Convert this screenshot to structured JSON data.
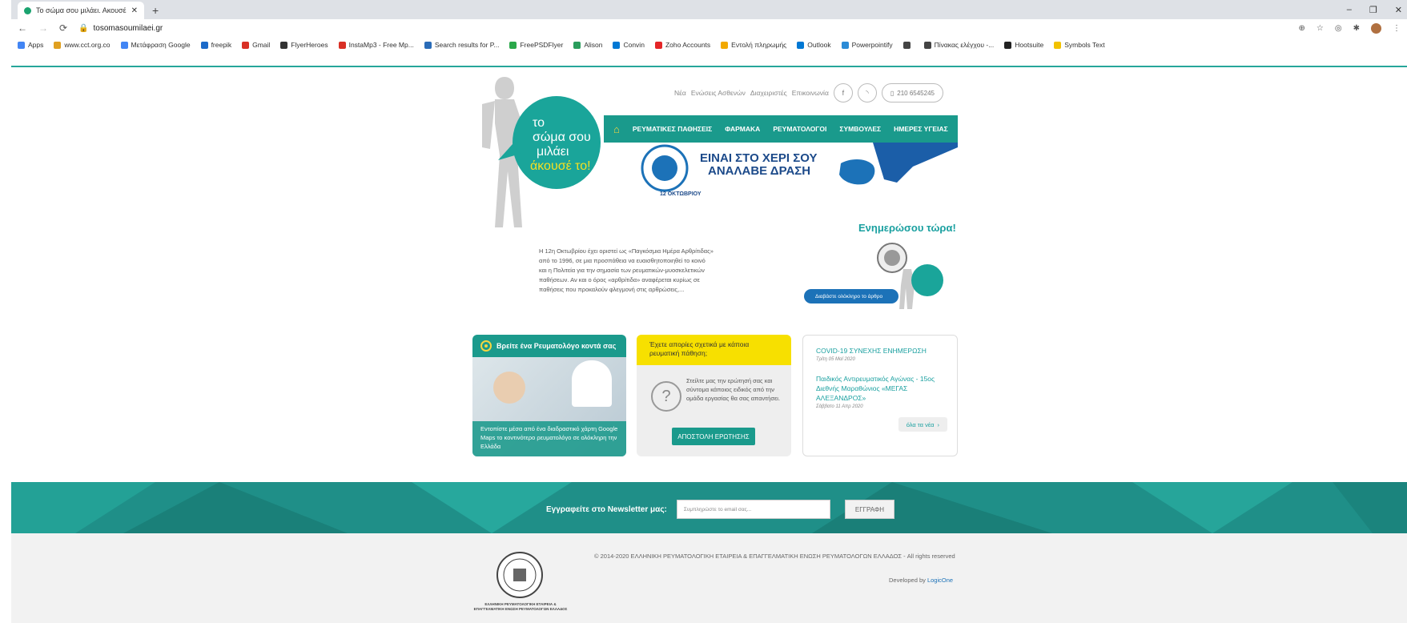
{
  "browser": {
    "tab_title": "Το σώμα σου μιλάει. Ακουσέ το!",
    "url": "tosomasoumilaei.gr",
    "bookmarks": [
      {
        "label": "Apps",
        "color": "#4285f4"
      },
      {
        "label": "www.cct.org.co",
        "color": "#e0a020"
      },
      {
        "label": "Μετάφραση Google",
        "color": "#4285f4"
      },
      {
        "label": "freepik",
        "color": "#1b6ac9"
      },
      {
        "label": "Gmail",
        "color": "#d93025"
      },
      {
        "label": "FlyerHeroes",
        "color": "#333333"
      },
      {
        "label": "InstaMp3 - Free Mp...",
        "color": "#d93025"
      },
      {
        "label": "Search results for P...",
        "color": "#2a6cb8"
      },
      {
        "label": "FreePSDFlyer",
        "color": "#2aa84a"
      },
      {
        "label": "Alison",
        "color": "#2a9d5c"
      },
      {
        "label": "Convin",
        "color": "#0078d4"
      },
      {
        "label": "Zoho Accounts",
        "color": "#e42527"
      },
      {
        "label": "Εντολή πληρωμής",
        "color": "#f2a900"
      },
      {
        "label": "Outlook",
        "color": "#0078d4"
      },
      {
        "label": "Powerpointify",
        "color": "#2b8bd6"
      },
      {
        "label": "",
        "color": "#444444"
      },
      {
        "label": "Πίνακας ελέγχου -...",
        "color": "#444444"
      },
      {
        "label": "Hootsuite",
        "color": "#222222"
      },
      {
        "label": "Symbols Text",
        "color": "#f2c200"
      }
    ]
  },
  "site": {
    "logo": {
      "line1": "το",
      "line2": "σώμα σου",
      "line3": "μιλάει",
      "line4": "άκουσέ το!"
    },
    "topnav": {
      "news": "Νέα",
      "patients": "Ενώσεις Ασθενών",
      "admins": "Διαχειριστές",
      "contact": "Επικοινωνία",
      "phone": "210 6545245"
    },
    "menu": [
      "ΡΕΥΜΑΤΙΚΕΣ ΠΑΘΗΣΕΙΣ",
      "ΦΑΡΜΑΚΑ",
      "ΡΕΥΜΑΤΟΛΟΓΟΙ",
      "ΣΥΜΒΟΥΛΕΣ",
      "ΗΜΕΡΕΣ ΥΓΕΙΑΣ"
    ],
    "banner": {
      "line1": "ΕΙΝΑΙ ΣΤΟ ΧΕΡΙ ΣΟΥ",
      "line2": "ΑΝΑΛΑΒΕ ΔΡΑΣΗ",
      "badge": "12 ΟΚΤΩΒΡΙΟΥ"
    },
    "inform_title": "Ενημερώσου τώρα!",
    "intro": "Η 12η Οκτωβρίου έχει οριστεί ως «Παγκόσμια Ημέρα Αρθρίτιδας» από το 1996, σε μια προσπάθεια να ευαισθητοποιηθεί το κοινό και η Πολιτεία για την σημασία των ρευματικών-μυοσκελετικών παθήσεων. Αν και ο όρος «αρθρίτιδα» αναφέρεται κυρίως σε παθήσεις που προκαλούν φλεγμονή στις αρθρώσεις,...",
    "readmore": "Διαβάστε ολόκληρο το άρθρο",
    "card_find": {
      "title": "Βρείτε ένα Ρευματολόγο κοντά σας",
      "caption": "Εντοπίστε μέσα από ένα διαδραστικό χάρτη Google Maps το κοντινότερο ρευματολόγο σε ολόκληρη την Ελλάδα"
    },
    "card_ask": {
      "title": "Έχετε απορίες σχετικά με κάποια ρευματική πάθηση;",
      "text": "Στείλτε μας την ερώτησή σας και σύντομα κάποιος ειδικός από την ομάδα εργασίας θα σας απαντήσει.",
      "button": "ΑΠΟΣΤΟΛΗ ΕΡΩΤΗΣΗΣ"
    },
    "card_news": {
      "item1_title": "COVID-19 ΣΥΝΕΧΗΣ ΕΝΗΜΕΡΩΣΗ",
      "item1_date": "Τρίτη 05 Μαϊ 2020",
      "item2_title": "Παιδικός Αντιρευματικός Αγώνας - 15ος Διεθνής Μαραθώνιος «ΜΕΓΑΣ ΑΛΕΞΑΝΔΡΟΣ»",
      "item2_date": "Σάββατο 11 Απρ 2020",
      "all_news": "όλα τα νέα"
    },
    "newsletter": {
      "label": "Εγγραφείτε στο Newsletter μας:",
      "placeholder": "Συμπληρώστε το email σας...",
      "button": "ΕΓΓΡΑΦΗ"
    },
    "footer": {
      "seal_text": "ΕΛΛΗΝΙΚΗ ΡΕΥΜΑΤΟΛΟΓΙΚΗ ΕΤΑΙΡΕΙΑ & ΕΠΑΓΓΕΛΜΑΤΙΚΗ ΕΝΩΣΗ ΡΕΥΜΑΤΟΛΟΓΩΝ ΕΛΛΑΔΟΣ",
      "copyright": "© 2014-2020 ΕΛΛΗΝΙΚΗ ΡΕΥΜΑΤΟΛΟΓΙΚΗ ΕΤΑΙΡΕΙΑ & ΕΠΑΓΓΕΛΜΑΤΙΚΗ ΕΝΩΣΗ ΡΕΥΜΑΤΟΛΟΓΩΝ ΕΛΛΑΔΟΣ - All rights reserved",
      "developed_by": "Developed by",
      "developer": "LogicOne"
    }
  },
  "colors": {
    "teal": "#1a9a8c",
    "yellow": "#f7e000",
    "blue": "#1c72b8"
  }
}
